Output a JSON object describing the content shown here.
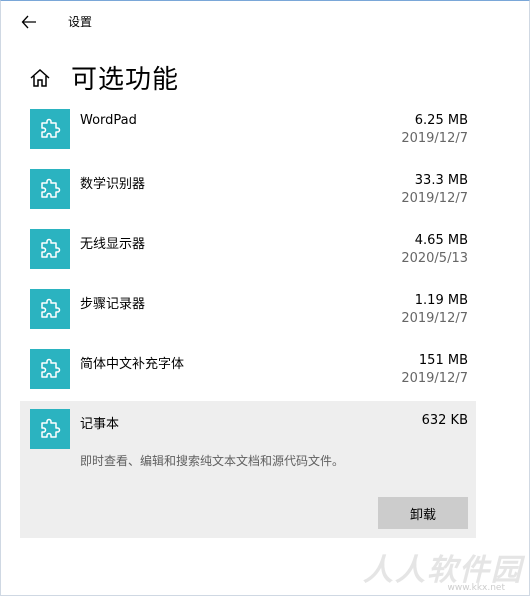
{
  "titlebar": {
    "title": "设置"
  },
  "page": {
    "title": "可选功能"
  },
  "features": [
    {
      "name": "WordPad",
      "size": "6.25 MB",
      "date": "2019/12/7"
    },
    {
      "name": "数学识别器",
      "size": "33.3 MB",
      "date": "2019/12/7"
    },
    {
      "name": "无线显示器",
      "size": "4.65 MB",
      "date": "2020/5/13"
    },
    {
      "name": "步骤记录器",
      "size": "1.19 MB",
      "date": "2019/12/7"
    },
    {
      "name": "简体中文补充字体",
      "size": "151 MB",
      "date": "2019/12/7"
    }
  ],
  "selected_feature": {
    "name": "记事本",
    "size": "632 KB",
    "description": "即时查看、编辑和搜索纯文本文档和源代码文件。",
    "uninstall_label": "卸载"
  },
  "watermark": {
    "text": "人人软件园",
    "url": "www.kkx.net"
  },
  "colors": {
    "tile": "#2bb3c0",
    "selected_bg": "#eeeeee",
    "button_bg": "#cccccc"
  },
  "icons": {
    "back": "back-arrow-icon",
    "home": "home-icon",
    "feature": "puzzle-piece-icon"
  }
}
